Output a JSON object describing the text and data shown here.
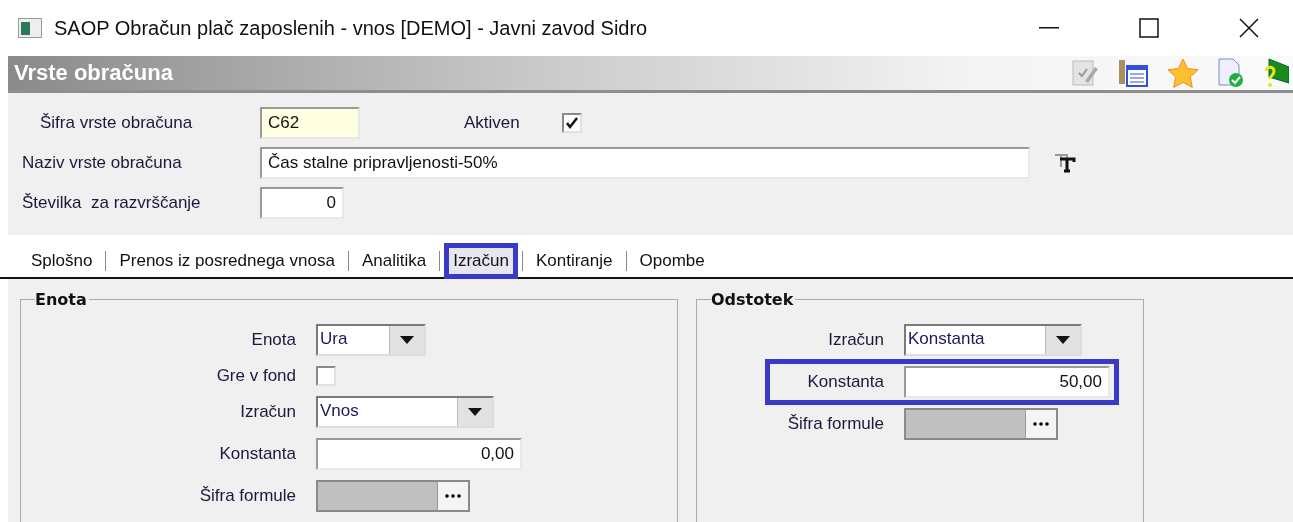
{
  "window": {
    "title": "SAOP Obračun plač zaposlenih - vnos [DEMO] - Javni zavod Sidro"
  },
  "header": {
    "title": "Vrste obračuna"
  },
  "form": {
    "code": {
      "label": "Šifra vrste obračuna",
      "value": "C62"
    },
    "active": {
      "label": "Aktiven",
      "checked": true
    },
    "name": {
      "label": "Naziv vrste obračuna",
      "value": "Čas stalne pripravljenosti-50%"
    },
    "sort": {
      "label": "Številka  za razvrščanje",
      "value": "0"
    }
  },
  "tabs": [
    {
      "label": "Splošno",
      "selected": false
    },
    {
      "label": "Prenos iz posrednega vnosa",
      "selected": false
    },
    {
      "label": "Analitika",
      "selected": false
    },
    {
      "label": "Izračun",
      "selected": true
    },
    {
      "label": "Kontiranje",
      "selected": false
    },
    {
      "label": "Opombe",
      "selected": false
    }
  ],
  "panels": [
    {
      "title": "Enota",
      "fields": [
        {
          "kind": "select",
          "label": "Enota",
          "value": "Ura",
          "highlighted": false
        },
        {
          "kind": "checkbox",
          "label": "Gre v fond",
          "checked": false,
          "highlighted": false
        },
        {
          "kind": "select",
          "label": "Izračun",
          "value": "Vnos",
          "highlighted": false
        },
        {
          "kind": "number",
          "label": "Konstanta",
          "value": "0,00",
          "highlighted": false
        },
        {
          "kind": "lookup",
          "label": "Šifra formule",
          "highlighted": false
        }
      ]
    },
    {
      "title": "Odstotek",
      "fields": [
        {
          "kind": "select",
          "label": "Izračun",
          "value": "Konstanta",
          "highlighted": false
        },
        {
          "kind": "number",
          "label": "Konstanta",
          "value": "50,00",
          "highlighted": true
        },
        {
          "kind": "lookup",
          "label": "Šifra formule",
          "highlighted": false
        }
      ]
    }
  ]
}
